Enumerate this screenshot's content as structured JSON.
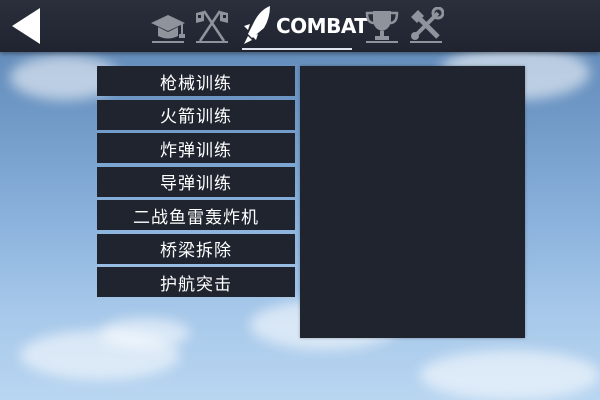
{
  "header": {
    "back_icon": "back-arrow-icon",
    "tabs": [
      {
        "icon": "graduation-cap-icon",
        "label": ""
      },
      {
        "icon": "crossed-flags-icon",
        "label": ""
      },
      {
        "icon": "rocket-icon",
        "label": "COMBAT",
        "active": true
      },
      {
        "icon": "trophy-icon",
        "label": ""
      },
      {
        "icon": "tools-icon",
        "label": ""
      }
    ]
  },
  "menu": {
    "items": [
      {
        "label": "枪械训练"
      },
      {
        "label": "火箭训练"
      },
      {
        "label": "炸弹训练"
      },
      {
        "label": "导弹训练"
      },
      {
        "label": "二战鱼雷轰炸机"
      },
      {
        "label": "桥梁拆除"
      },
      {
        "label": "护航突击"
      }
    ]
  },
  "colors": {
    "bar_bg": "#1f2430",
    "panel_bg": "#1f242f",
    "icon_inactive": "#8f939b",
    "icon_active": "#ffffff",
    "sky_top": "#5d84b2",
    "sky_bottom": "#b9d6f1"
  }
}
